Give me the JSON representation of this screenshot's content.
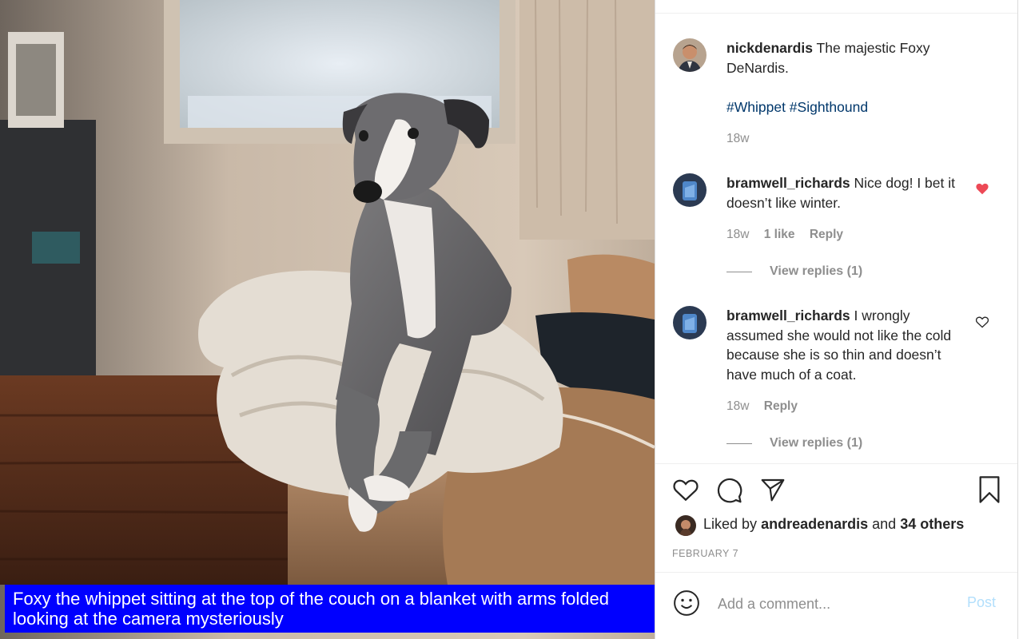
{
  "post": {
    "author": "nickdenardis",
    "caption": "The majestic Foxy DeNardis.",
    "hashtags": "#Whippet #Sighthound",
    "time": "18w"
  },
  "comments": [
    {
      "username": "bramwell_richards",
      "text": "Nice dog! I bet it doesn’t like winter.",
      "time": "18w",
      "likes": "1 like",
      "reply_label": "Reply",
      "view_replies": "View replies (1)",
      "liked": true
    },
    {
      "username": "bramwell_richards",
      "text": "I wrongly assumed she would not like the cold because she is so thin and doesn’t have much of a coat.",
      "time": "18w",
      "reply_label": "Reply",
      "view_replies": "View replies (1)",
      "liked": false
    }
  ],
  "actions": {
    "icons": [
      "heart-icon",
      "comment-icon",
      "share-icon",
      "bookmark-icon"
    ]
  },
  "likes_summary": {
    "prefix": "Liked by",
    "user": "andreadenardis",
    "middle": "and",
    "others": "34 others"
  },
  "date": "FEBRUARY 7",
  "add_comment": {
    "placeholder": "Add a comment...",
    "post_label": "Post"
  },
  "image_caption": "Foxy the whippet sitting at the top of the couch on a blanket with arms folded looking at the camera mysteriously",
  "colors": {
    "like_red": "#ed4956",
    "post_blue_disabled": "#b2dffc",
    "hashtag_blue": "#00376b",
    "caption_bar": "#0000ff"
  }
}
